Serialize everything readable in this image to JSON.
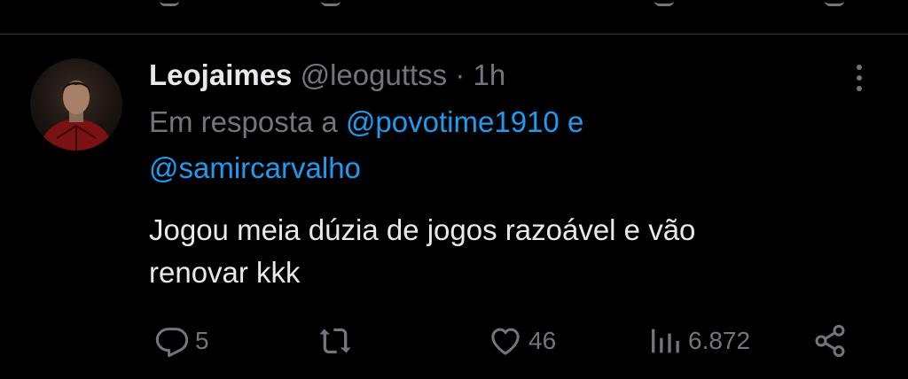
{
  "tweet": {
    "display_name": "Leojaimes",
    "handle": "@leoguttss",
    "separator": "·",
    "time": "1h",
    "reply_prefix": "Em resposta a",
    "reply_mention_1": "@povotime1910",
    "reply_and": "e",
    "reply_mention_2": "@samircarvalho",
    "text_line_1": "Jogou meia dúzia de jogos razoável e vão",
    "text_line_2": "renovar kkk"
  },
  "actions": {
    "reply_count": "5",
    "retweet_count": "",
    "like_count": "46",
    "view_count": "6.872"
  },
  "icons": {
    "reply": "reply-icon",
    "retweet": "retweet-icon",
    "like": "heart-icon",
    "views": "views-icon",
    "share": "share-icon",
    "more": "more-options-icon"
  },
  "colors": {
    "background": "#000000",
    "text_primary": "#e7e9ea",
    "text_secondary": "#71767b",
    "link": "#1d9bf0",
    "divider": "#2f3336"
  }
}
